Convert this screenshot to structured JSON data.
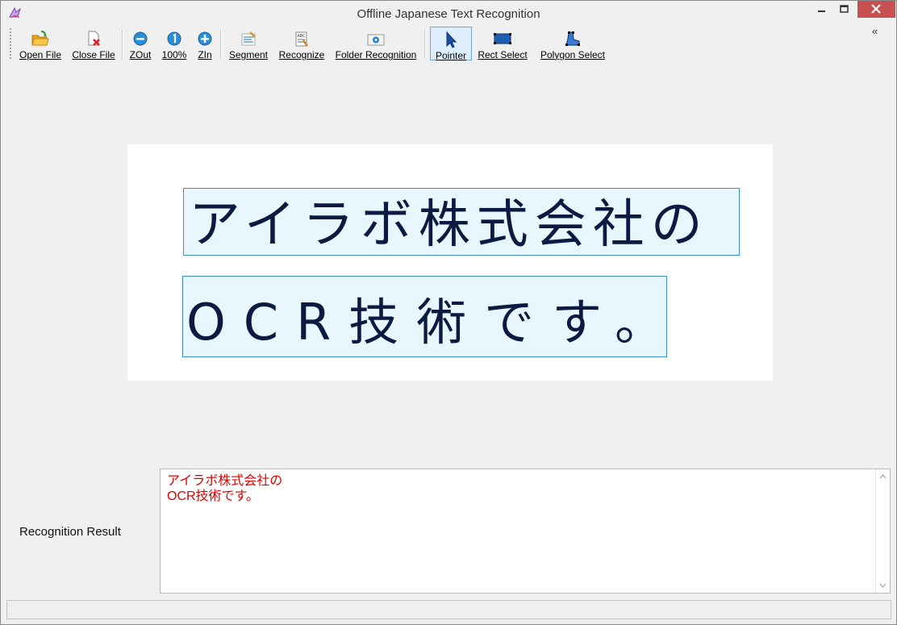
{
  "window": {
    "title": "Offline Japanese Text Recognition"
  },
  "toolbar": {
    "open_file": "Open File",
    "close_file": "Close File",
    "zoom_out": "ZOut",
    "zoom_100": "100%",
    "zoom_in": "ZIn",
    "segment": "Segment",
    "recognize": "Recognize",
    "folder_recognition": "Folder Recognition",
    "pointer": "Pointer",
    "rect_select": "Rect Select",
    "polygon_select": "Polygon Select",
    "overflow": "«"
  },
  "document": {
    "handwritten_lines": [
      "アイラボ株式会社の",
      "OCR技術です。"
    ]
  },
  "result": {
    "label": "Recognition Result",
    "text": "アイラボ株式会社の\nOCR技術です。"
  },
  "colors": {
    "result_text": "#e00000",
    "selection_border": "#3a8fd3",
    "selection_fill": "#e7f7fd"
  }
}
